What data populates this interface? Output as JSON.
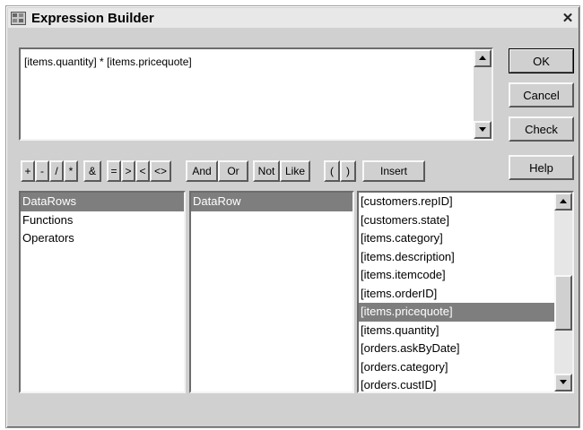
{
  "window": {
    "title": "Expression Builder",
    "close_glyph": "✕"
  },
  "expression": {
    "value": "[items.quantity] * [items.pricequote]"
  },
  "buttons": {
    "ok": "OK",
    "cancel": "Cancel",
    "check": "Check",
    "help": "Help",
    "insert": "Insert"
  },
  "operators": [
    "+",
    "-",
    "/",
    "*",
    "&",
    "=",
    ">",
    "<",
    "<>",
    "And",
    "Or",
    "Not",
    "Like",
    "(",
    ")"
  ],
  "lists": {
    "categories": {
      "items": [
        "DataRows",
        "Functions",
        "Operators"
      ],
      "selected": "DataRows"
    },
    "subcategories": {
      "items": [
        "DataRow"
      ],
      "selected": "DataRow"
    },
    "fields": {
      "items": [
        "[customers.repID]",
        "[customers.state]",
        "[items.category]",
        "[items.description]",
        "[items.itemcode]",
        "[items.orderID]",
        "[items.pricequote]",
        "[items.quantity]",
        "[orders.askByDate]",
        "[orders.category]",
        "[orders.custID]"
      ],
      "selected": "[items.pricequote]"
    }
  },
  "icons": {
    "title": "expression-builder-icon",
    "close": "close-icon",
    "scroll_up": "scroll-up-arrow-icon",
    "scroll_down": "scroll-down-arrow-icon"
  },
  "colors": {
    "selection": "#7e7e7e",
    "face": "#d0d0d0"
  }
}
